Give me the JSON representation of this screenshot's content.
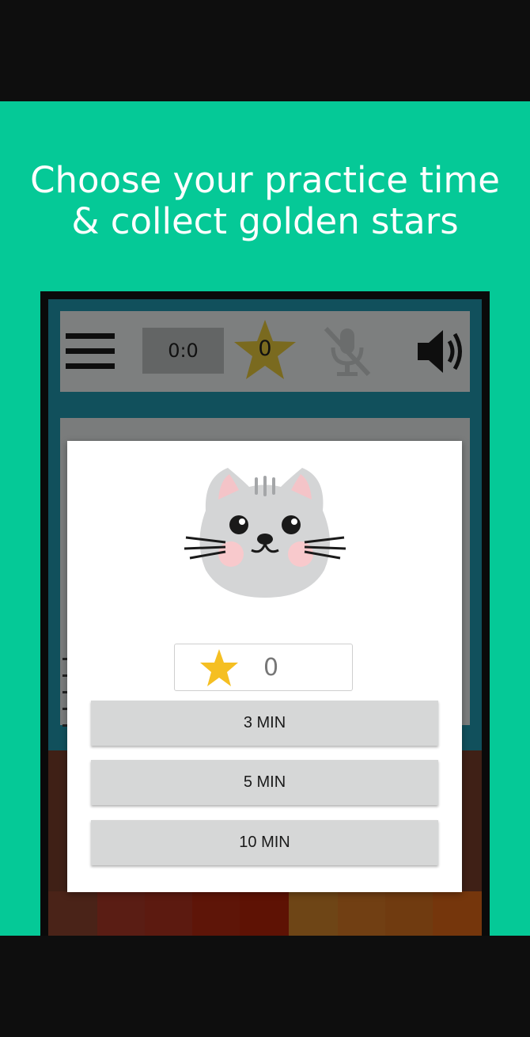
{
  "promo": {
    "line1": "Choose your practice time",
    "line2": "& collect golden stars"
  },
  "toolbar": {
    "timer": "0:0",
    "stars": "0"
  },
  "dialog": {
    "star_count": "0",
    "buttons": [
      {
        "label": "3 MIN"
      },
      {
        "label": "5 MIN"
      },
      {
        "label": "10 MIN"
      }
    ]
  },
  "colors": {
    "background": "#05c997",
    "star": "#f5bf22",
    "star_dim": "#7a6a1f"
  },
  "icons": [
    "menu-icon",
    "star-icon",
    "mic-off-icon",
    "speaker-icon",
    "cat-face-icon"
  ]
}
